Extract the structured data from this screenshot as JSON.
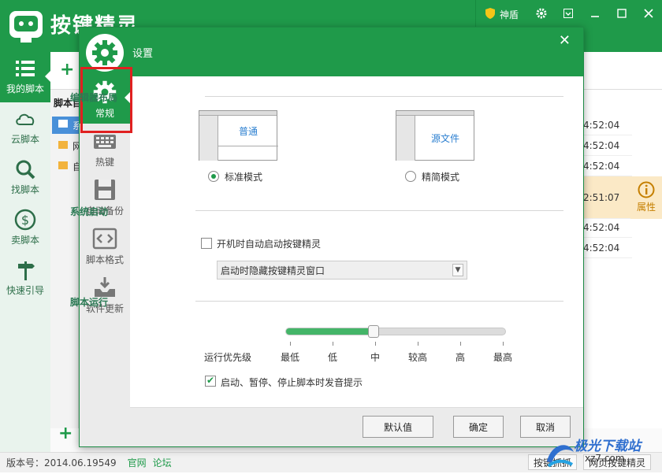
{
  "app": {
    "title": "按键精灵",
    "shield_label": "神盾",
    "version": "版本号：2014.06.19549",
    "link_official": "官网",
    "link_forum": "论坛",
    "status_btn_capture": "按键抓抓",
    "status_btn_web": "网页按键精灵"
  },
  "nav": {
    "items": [
      {
        "label": "我的脚本",
        "icon": "list-icon"
      },
      {
        "label": "云脚本",
        "icon": "cloud-icon"
      },
      {
        "label": "找脚本",
        "icon": "search-icon"
      },
      {
        "label": "卖脚本",
        "icon": "dollar-icon"
      },
      {
        "label": "快速引导",
        "icon": "signpost-icon"
      }
    ]
  },
  "tree": {
    "header": "脚本目",
    "items": [
      "系",
      "网",
      "自"
    ]
  },
  "list": {
    "times": [
      "4:52:04",
      "4:52:04",
      "4:52:04",
      "2:51:07",
      "4:52:04",
      "4:52:04"
    ],
    "attr_label": "属性"
  },
  "dialog": {
    "title": "设置",
    "side_items": [
      {
        "label": "常规",
        "icon": "gear-icon"
      },
      {
        "label": "热键",
        "icon": "keyboard-icon"
      },
      {
        "label": "自动备份",
        "icon": "save-icon"
      },
      {
        "label": "脚本格式",
        "icon": "code-icon"
      },
      {
        "label": "软件更新",
        "icon": "download-icon"
      }
    ],
    "editor_layout": {
      "title": "编辑器布局",
      "preview_normal": "普通",
      "preview_source": "源文件",
      "option_standard": "标准模式",
      "option_simple": "精简模式",
      "selected": "标准模式"
    },
    "startup": {
      "title": "系统启动",
      "autostart_label": "开机时自动启动按键精灵",
      "autostart_checked": false,
      "hide_select_value": "启动时隐藏按键精灵窗口"
    },
    "run": {
      "title": "脚本运行",
      "priority_label": "运行优先级",
      "priority_levels": [
        "最低",
        "低",
        "中",
        "较高",
        "高",
        "最高"
      ],
      "priority_value": "中",
      "priority_fraction": 0.4,
      "sound_label": "启动、暂停、停止脚本时发音提示",
      "sound_checked": true
    },
    "buttons": {
      "default": "默认值",
      "ok": "确定",
      "cancel": "取消"
    }
  },
  "watermark": {
    "text": "极光下载站",
    "sub": "xz7.com"
  },
  "colors": {
    "brand_green": "#1f9a4a",
    "highlight": "#e02020"
  }
}
